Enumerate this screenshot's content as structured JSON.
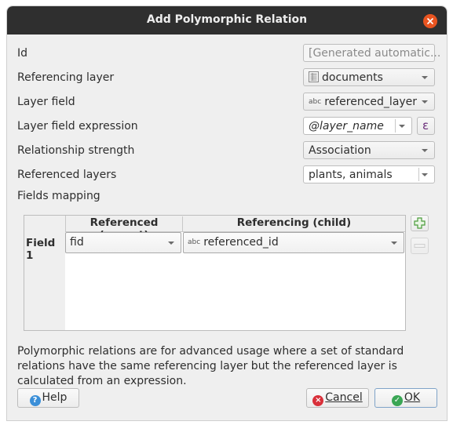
{
  "window": {
    "title": "Add Polymorphic Relation"
  },
  "form": {
    "id": {
      "label": "Id",
      "placeholder": "[Generated automatic..."
    },
    "referencing_layer": {
      "label": "Referencing layer",
      "value": "documents"
    },
    "layer_field": {
      "label": "Layer field",
      "value": "referenced_layer",
      "type_tag": "abc"
    },
    "layer_field_expression": {
      "label": "Layer field expression",
      "value": "@layer_name",
      "expr_button": "ε"
    },
    "relationship_strength": {
      "label": "Relationship strength",
      "value": "Association"
    },
    "referenced_layers": {
      "label": "Referenced layers",
      "value": "plants, animals"
    },
    "fields_mapping": {
      "label": "Fields mapping"
    }
  },
  "mapping_table": {
    "columns": [
      "Referenced (parent)",
      "Referencing (child)"
    ],
    "rows": [
      {
        "header": "Field 1",
        "parent": "fid",
        "child": "referenced_id",
        "child_type_tag": "abc"
      }
    ]
  },
  "description": "Polymorphic relations are for advanced usage where a set of standard relations have the same referencing layer but the referenced layer is calculated from an expression.",
  "buttons": {
    "help": "Help",
    "cancel": "Cancel",
    "ok": "OK"
  },
  "colors": {
    "titlebar": "#2f2f2f",
    "close": "#e95420",
    "add_green": "#4a9c3a",
    "help_blue": "#3b8fd8",
    "cancel_red": "#d9303a",
    "ok_green": "#3aa655"
  }
}
